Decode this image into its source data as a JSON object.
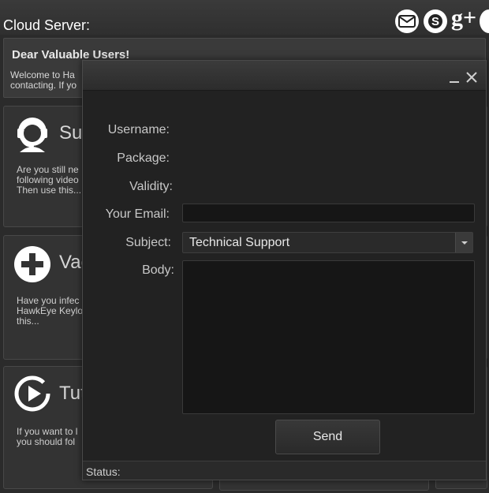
{
  "header": {
    "title": "Cloud Server:",
    "icons": [
      "email-icon",
      "skype-icon",
      "google-plus-icon",
      "globe-icon"
    ],
    "gplus_text": "g+"
  },
  "notice": {
    "title": "Dear Valuable Users!",
    "line1": "Welcome to Ha",
    "line2": "contacting. If yo"
  },
  "cards": [
    {
      "icon": "support-agent-icon",
      "title": "Sup",
      "lines": [
        "Are you still ne",
        "following video",
        "Then use this..."
      ]
    },
    {
      "icon": "plus-circle-icon",
      "title": "Vac",
      "lines": [
        "Have you infec",
        "HawkEye Keylo",
        "this..."
      ]
    },
    {
      "icon": "play-circle-icon",
      "title": "Tut",
      "lines": [
        "If you want to l",
        "you should fol"
      ]
    }
  ],
  "dialog": {
    "labels": {
      "username": "Username:",
      "package": "Package:",
      "validity": "Validity:",
      "email": "Your Email:",
      "subject": "Subject:",
      "body": "Body:"
    },
    "email_value": "",
    "subject_value": "Technical Support",
    "body_value": "",
    "send_label": "Send",
    "status_label": "Status:"
  },
  "colors": {
    "background": "#2b2b2b",
    "dialog_bg": "#222222",
    "input_bg": "#161616",
    "text": "#d0d0d0"
  }
}
